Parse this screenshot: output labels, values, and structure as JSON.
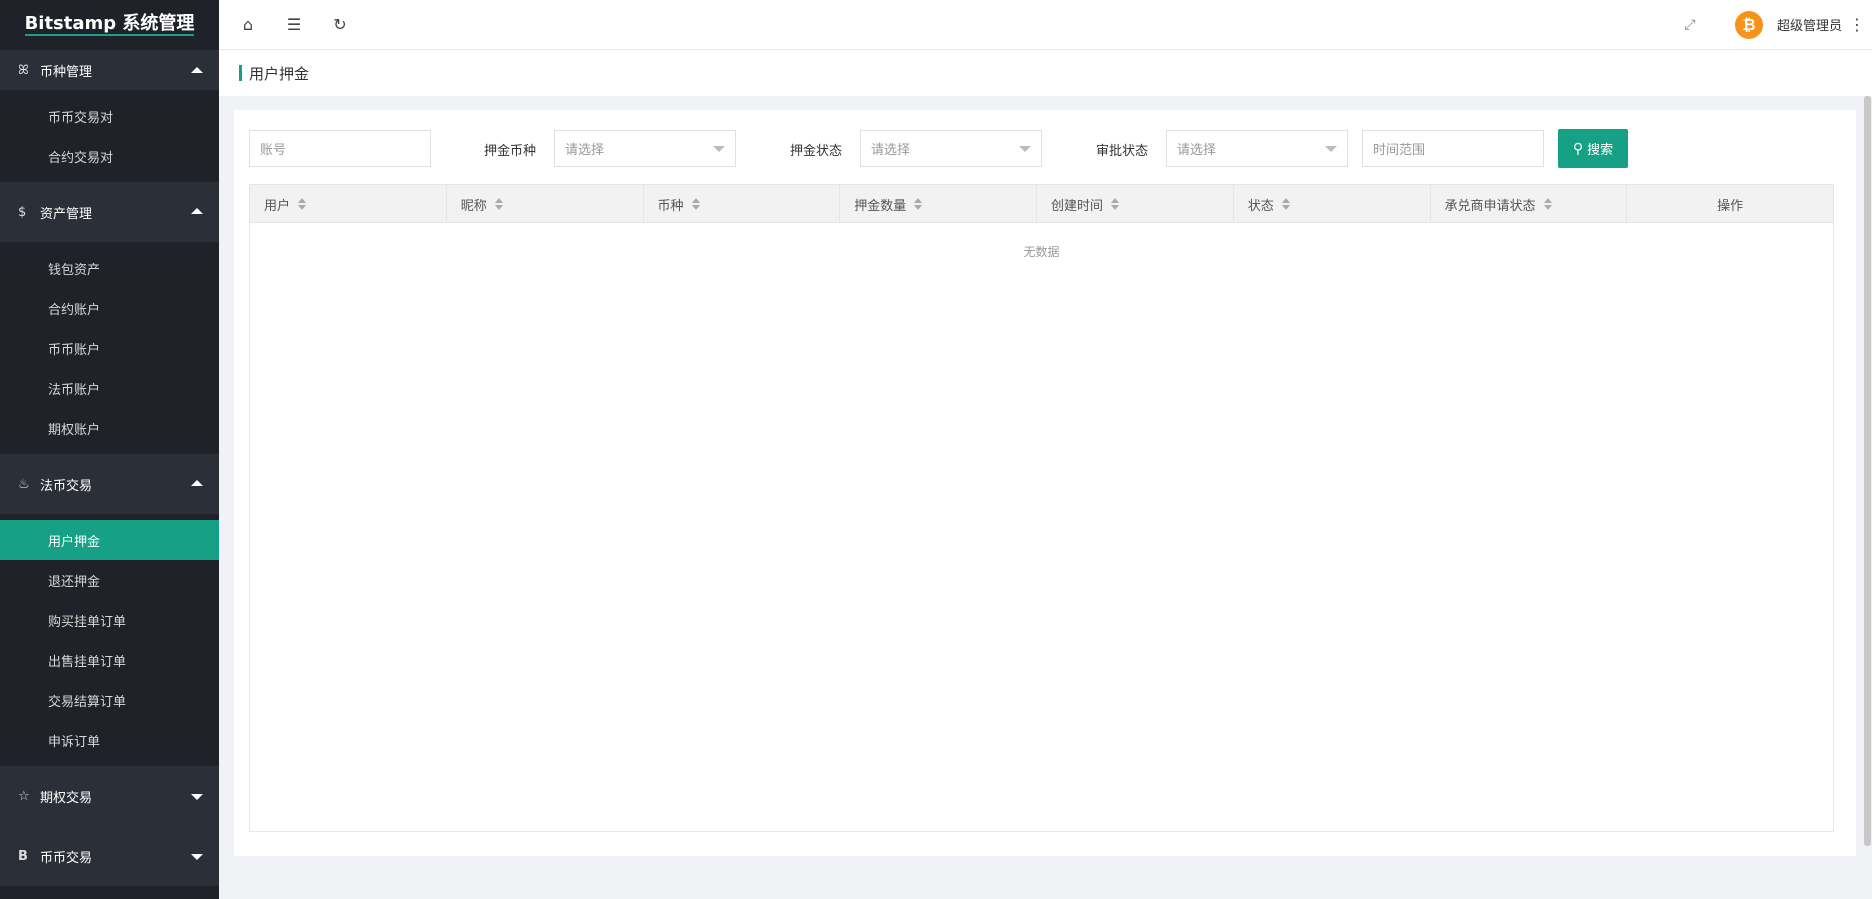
{
  "sidebar": {
    "logo": "Bitstamp 系统管理",
    "groups": [
      {
        "label": "币种管理",
        "icon": "drops-icon",
        "expanded": true,
        "items": [
          "币币交易对",
          "合约交易对"
        ]
      },
      {
        "label": "资产管理",
        "icon": "dollar-icon",
        "expanded": true,
        "items": [
          "钱包资产",
          "合约账户",
          "币币账户",
          "法币账户",
          "期权账户"
        ]
      },
      {
        "label": "法币交易",
        "icon": "fire-icon",
        "expanded": true,
        "items": [
          "用户押金",
          "退还押金",
          "购买挂单订单",
          "出售挂单订单",
          "交易结算订单",
          "申诉订单"
        ]
      },
      {
        "label": "期权交易",
        "icon": "star-icon",
        "expanded": false,
        "items": []
      },
      {
        "label": "币币交易",
        "icon": "b-icon",
        "expanded": false,
        "items": []
      }
    ],
    "active_item": "用户押金"
  },
  "topbar": {
    "user_name": "超级管理员",
    "avatar_glyph": "₿"
  },
  "breadcrumb": {
    "title": "用户押金"
  },
  "filters": {
    "account_placeholder": "账号",
    "coin_label": "押金币种",
    "coin_placeholder": "请选择",
    "deposit_status_label": "押金状态",
    "deposit_status_placeholder": "请选择",
    "audit_status_label": "审批状态",
    "audit_status_placeholder": "请选择",
    "time_placeholder": "时间范围",
    "search_label": "搜索"
  },
  "table": {
    "columns": [
      "用户",
      "昵称",
      "币种",
      "押金数量",
      "创建时间",
      "状态",
      "承兑商申请状态",
      "操作"
    ],
    "empty_text": "无数据"
  },
  "colors": {
    "accent": "#16a085",
    "sidebar_bg": "#1f2229",
    "btc": "#f7931a"
  }
}
